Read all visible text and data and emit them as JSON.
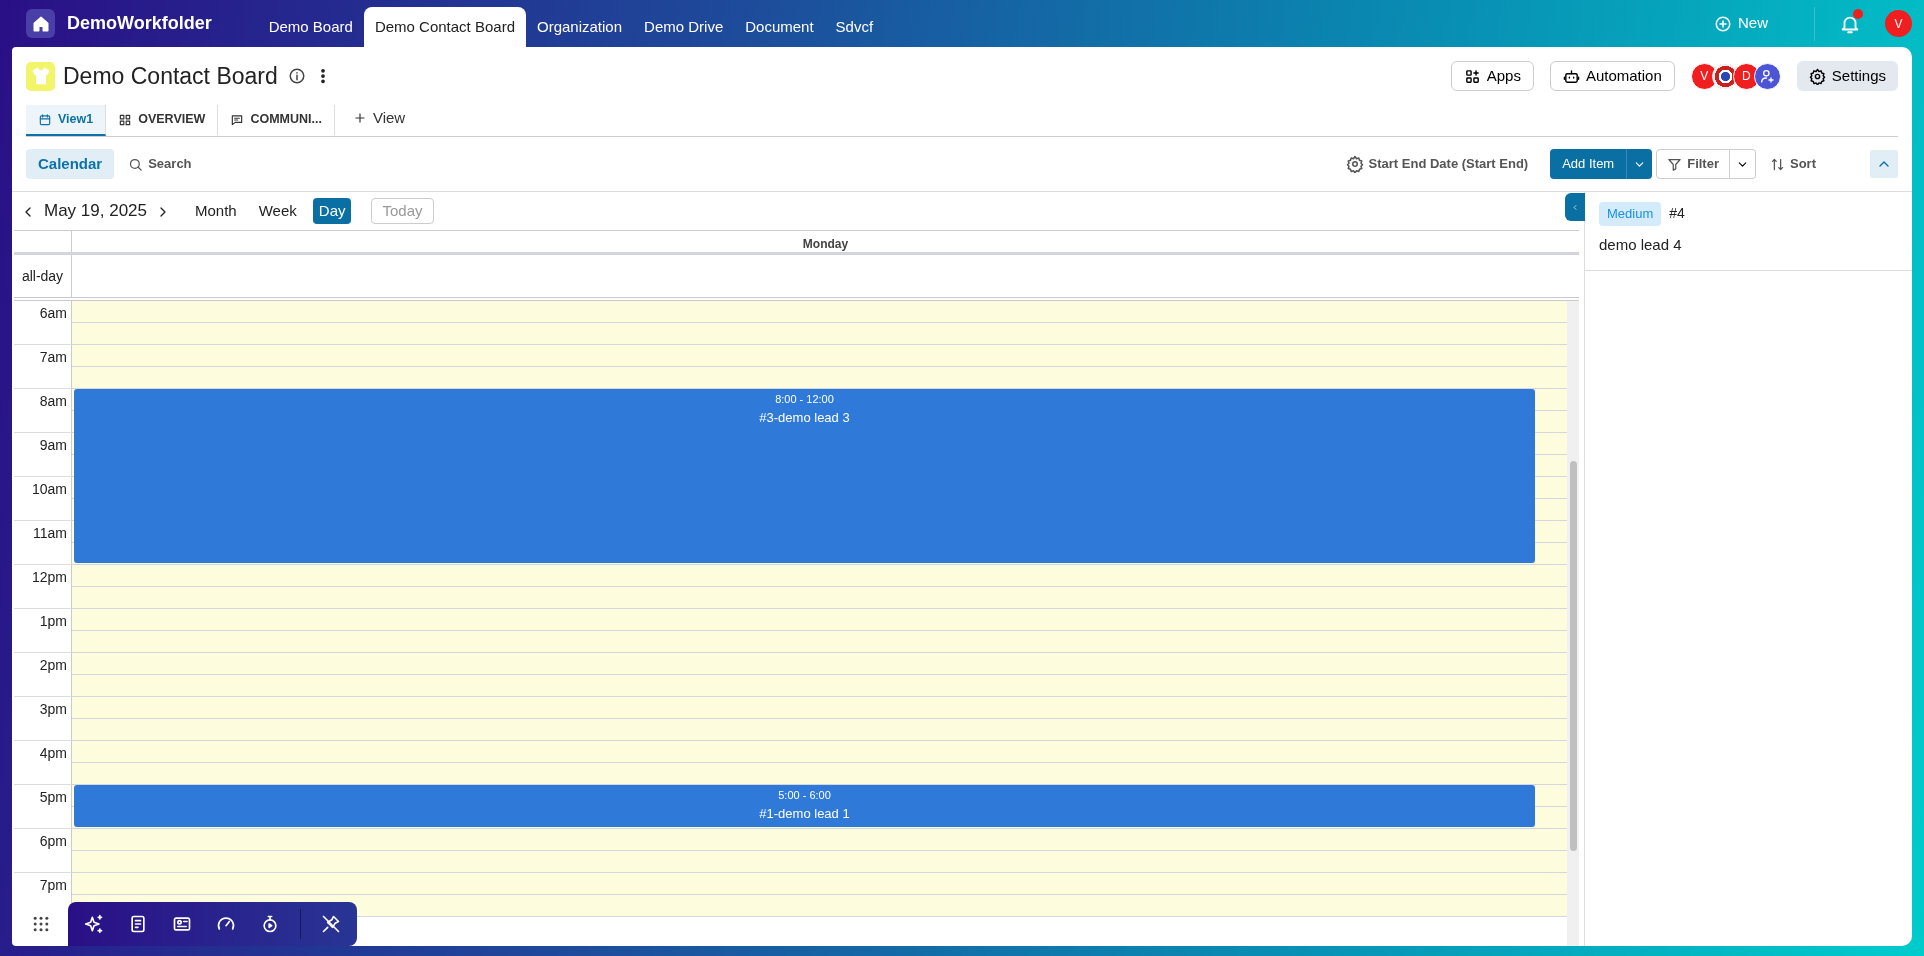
{
  "topbar": {
    "brand": "DemoWorkfolder",
    "tabs": [
      {
        "label": "Demo Board",
        "selected": false
      },
      {
        "label": "Demo Contact Board",
        "selected": true
      },
      {
        "label": "Organization",
        "selected": false
      },
      {
        "label": "Demo Drive",
        "selected": false
      },
      {
        "label": "Document",
        "selected": false
      },
      {
        "label": "Sdvcf",
        "selected": false
      }
    ],
    "new_label": "New",
    "has_notification": true,
    "user_initial": "V"
  },
  "board": {
    "title": "Demo Contact Board",
    "views": [
      {
        "label": "View1",
        "kind": "calendar",
        "selected": true
      },
      {
        "label": "OVERVIEW",
        "kind": "grid",
        "selected": false
      },
      {
        "label": "COMMUNI...",
        "kind": "chat",
        "selected": false
      }
    ],
    "add_view": "View",
    "apps": "Apps",
    "automation": "Automation",
    "members": [
      {
        "kind": "letter",
        "initial": "V"
      },
      {
        "kind": "image"
      },
      {
        "kind": "letter",
        "initial": "D"
      },
      {
        "kind": "add"
      }
    ],
    "settings": "Settings"
  },
  "toolbar": {
    "calendar": "Calendar",
    "search": "Search",
    "date_field": "Start End Date (Start End)",
    "add_item": "Add Item",
    "filter": "Filter",
    "sort": "Sort"
  },
  "calendar": {
    "date": "May 19, 2025",
    "modes": [
      {
        "label": "Month",
        "selected": false
      },
      {
        "label": "Week",
        "selected": false
      },
      {
        "label": "Day",
        "selected": true
      }
    ],
    "today": {
      "label": "Today",
      "disabled": true
    },
    "day_header": "Monday",
    "allday_label": "all-day",
    "hours": [
      {
        "label": "6am"
      },
      {
        "label": "7am"
      },
      {
        "label": "8am",
        "events": [
          {
            "time": "8:00 - 12:00",
            "title": "#3-demo lead 3"
          }
        ]
      },
      {
        "label": "9am"
      },
      {
        "label": "10am"
      },
      {
        "label": "11am"
      },
      {
        "label": "12pm"
      },
      {
        "label": "1pm"
      },
      {
        "label": "2pm"
      },
      {
        "label": "3pm"
      },
      {
        "label": "4pm"
      },
      {
        "label": "5pm",
        "events": [
          {
            "time": "5:00 - 6:00",
            "title": "#1-demo lead 1"
          }
        ]
      },
      {
        "label": "6pm"
      },
      {
        "label": "7pm"
      }
    ]
  },
  "side_panel": {
    "cards": [
      {
        "priority": "Medium",
        "number": "#4",
        "title": "demo lead 4"
      }
    ]
  }
}
